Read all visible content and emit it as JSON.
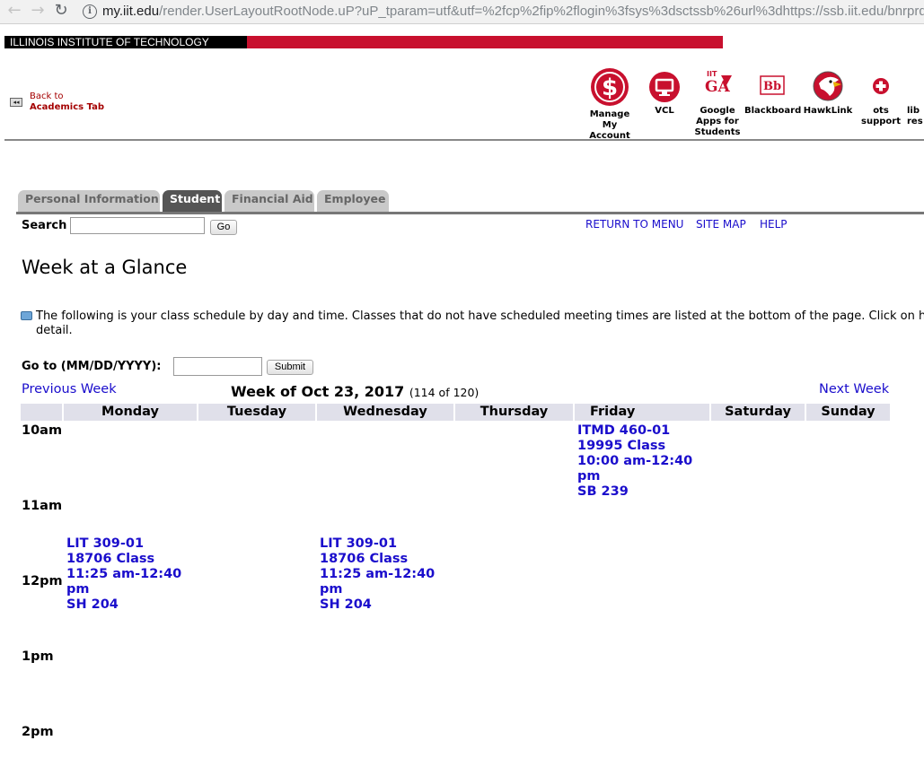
{
  "browser": {
    "back_glyph": "←",
    "forward_glyph": "→",
    "reload_glyph": "↻",
    "info_glyph": "i",
    "url_host": "my.iit.edu",
    "url_rest": "/render.UserLayoutRootNode.uP?uP_tparam=utf&utf=%2fcp%2fip%2flogin%3fsys%3dsctssb%26url%3dhttps://ssb.iit.edu/bnrprd/bw"
  },
  "portal": {
    "institution": "ILLINOIS INSTITUTE OF TECHNOLOGY",
    "brand_color": "#c8102e",
    "back_line1": "Back to",
    "back_line2": "Academics Tab",
    "back_glyph": "◂◂",
    "quicklinks": [
      {
        "label": "Manage My Account",
        "icon": "dollar-icon"
      },
      {
        "label": "VCL",
        "icon": "monitor-icon"
      },
      {
        "label": "Google Apps for Students",
        "icon": "google-apps-icon"
      },
      {
        "label": "Blackboard",
        "icon": "blackboard-icon"
      },
      {
        "label": "HawkLink",
        "icon": "hawk-icon"
      },
      {
        "label": "ots support",
        "icon": "medical-cross-icon"
      },
      {
        "label": "lib res",
        "icon": "library-icon"
      }
    ]
  },
  "tabs": [
    "Personal Information",
    "Student",
    "Financial Aid",
    "Employee"
  ],
  "active_tab": "Student",
  "search": {
    "label": "Search",
    "button": "Go",
    "value": ""
  },
  "top_links": [
    "RETURN TO MENU",
    "SITE MAP",
    "HELP"
  ],
  "page_title": "Week at a Glance",
  "info_message": {
    "line1": "The following is your class schedule by day and time. Classes that do not have scheduled meeting times are listed at the bottom of the page. Click on h",
    "line2": "detail."
  },
  "goto": {
    "label": "Go to (MM/DD/YYYY):",
    "button": "Submit",
    "value": ""
  },
  "week_nav": {
    "previous": "Previous Week",
    "next": "Next Week",
    "title": "Week of Oct 23, 2017",
    "count": "(114 of 120)"
  },
  "days": [
    "Monday",
    "Tuesday",
    "Wednesday",
    "Thursday",
    "Friday",
    "Saturday",
    "Sunday"
  ],
  "hours": [
    "10am",
    "11am",
    "12pm",
    "1pm",
    "2pm"
  ],
  "events": {
    "itmd_friday": {
      "course": "ITMD 460-01",
      "crn": "19995 Class",
      "time1": "10:00 am-12:40",
      "time2": "pm",
      "room": "SB 239"
    },
    "lit_monday": {
      "course": "LIT 309-01",
      "crn": "18706 Class",
      "time1": "11:25 am-12:40",
      "time2": "pm",
      "room": "SH 204"
    },
    "lit_wednesday": {
      "course": "LIT 309-01",
      "crn": "18706 Class",
      "time1": "11:25 am-12:40",
      "time2": "pm",
      "room": "SH 204"
    }
  },
  "colors": {
    "link": "#1a0dcc",
    "header_row": "#e0e0ea",
    "active_tab": "#555555",
    "tab": "#c9c9c9"
  }
}
